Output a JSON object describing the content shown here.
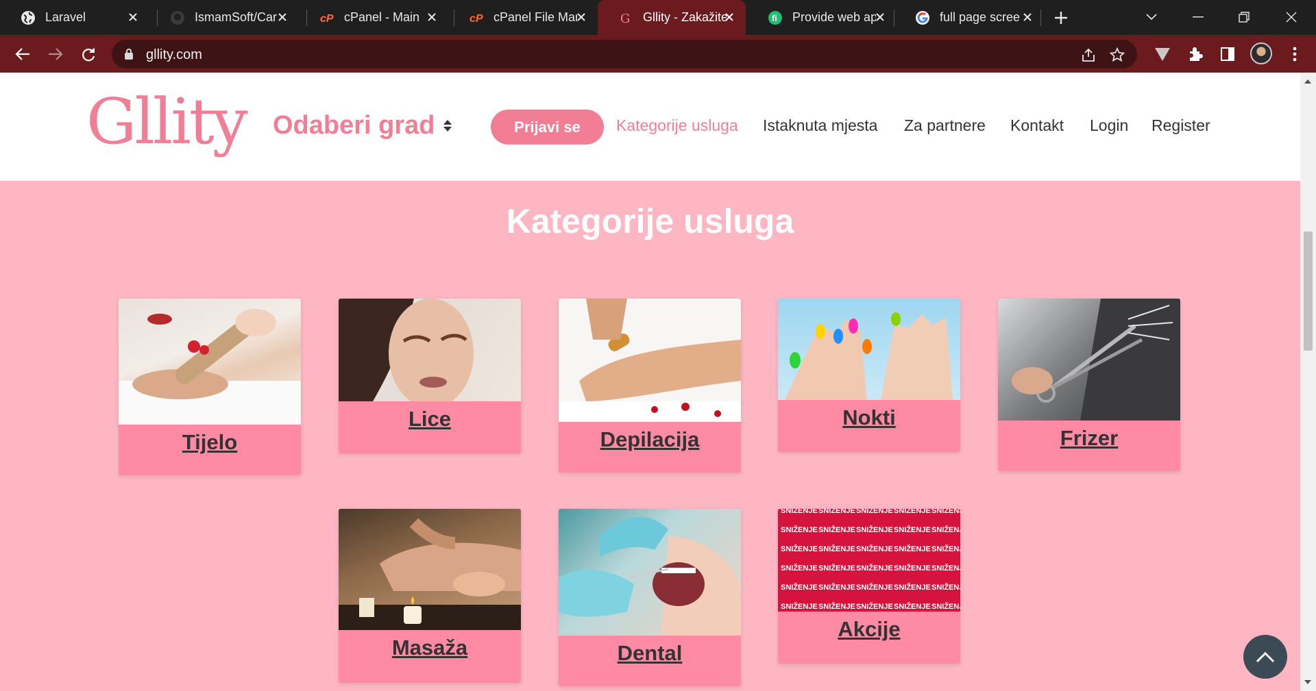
{
  "browser": {
    "tabs": [
      {
        "title": "Laravel",
        "icon": "globe-icon",
        "active": false
      },
      {
        "title": "IsmamSoft/Car",
        "icon": "github-icon",
        "active": false
      },
      {
        "title": "cPanel - Main",
        "icon": "cpanel-icon",
        "active": false
      },
      {
        "title": "cPanel File Mar",
        "icon": "cpanel-icon",
        "active": false
      },
      {
        "title": "Gllity - Zakažite",
        "icon": "gllity-icon",
        "active": true
      },
      {
        "title": "Provide web ap",
        "icon": "fiverr-icon",
        "active": false
      },
      {
        "title": "full page scree",
        "icon": "google-icon",
        "active": false
      }
    ],
    "url": "gllity.com"
  },
  "site": {
    "logo": "Gllity",
    "city_select": "Odaberi grad",
    "login_button": "Prijavi se",
    "nav": [
      {
        "label": "Kategorije usluga",
        "active": true
      },
      {
        "label": "Istaknuta mjesta",
        "active": false
      },
      {
        "label": "Za partnere",
        "active": false
      },
      {
        "label": "Kontakt",
        "active": false
      },
      {
        "label": "Login",
        "active": false
      },
      {
        "label": "Register",
        "active": false
      }
    ],
    "section_title": "Kategorije usluga",
    "categories": [
      {
        "label": "Tijelo",
        "image": "body-massage-photo"
      },
      {
        "label": "Lice",
        "image": "face-makeup-photo"
      },
      {
        "label": "Depilacija",
        "image": "leg-waxing-photo"
      },
      {
        "label": "Nokti",
        "image": "colorful-nails-photo"
      },
      {
        "label": "Frizer",
        "image": "hair-scissors-photo"
      },
      {
        "label": "Masaža",
        "image": "back-massage-photo"
      },
      {
        "label": "Dental",
        "image": "dental-checkup-photo"
      },
      {
        "label": "Akcije",
        "image": "snizenje-pattern",
        "pattern_text": "SNIŽENJE"
      }
    ]
  },
  "colors": {
    "brand_pink": "#f27e96",
    "page_background": "#fdb6c2",
    "card_background": "#ff8aa3",
    "browser_active_tab": "#6b1a1e"
  }
}
